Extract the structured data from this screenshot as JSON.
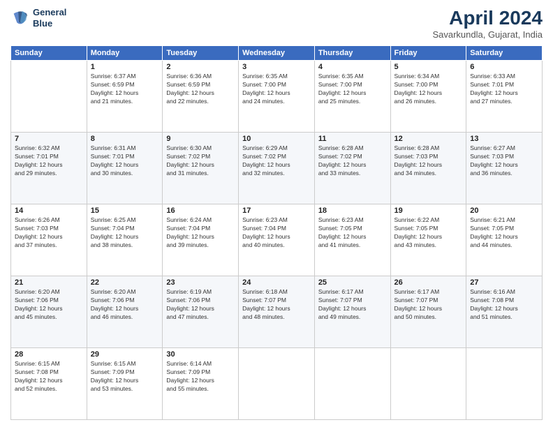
{
  "header": {
    "logo_line1": "General",
    "logo_line2": "Blue",
    "title": "April 2024",
    "subtitle": "Savarkundla, Gujarat, India"
  },
  "days_of_week": [
    "Sunday",
    "Monday",
    "Tuesday",
    "Wednesday",
    "Thursday",
    "Friday",
    "Saturday"
  ],
  "weeks": [
    [
      {
        "day": "",
        "info": ""
      },
      {
        "day": "1",
        "info": "Sunrise: 6:37 AM\nSunset: 6:59 PM\nDaylight: 12 hours\nand 21 minutes."
      },
      {
        "day": "2",
        "info": "Sunrise: 6:36 AM\nSunset: 6:59 PM\nDaylight: 12 hours\nand 22 minutes."
      },
      {
        "day": "3",
        "info": "Sunrise: 6:35 AM\nSunset: 7:00 PM\nDaylight: 12 hours\nand 24 minutes."
      },
      {
        "day": "4",
        "info": "Sunrise: 6:35 AM\nSunset: 7:00 PM\nDaylight: 12 hours\nand 25 minutes."
      },
      {
        "day": "5",
        "info": "Sunrise: 6:34 AM\nSunset: 7:00 PM\nDaylight: 12 hours\nand 26 minutes."
      },
      {
        "day": "6",
        "info": "Sunrise: 6:33 AM\nSunset: 7:01 PM\nDaylight: 12 hours\nand 27 minutes."
      }
    ],
    [
      {
        "day": "7",
        "info": "Sunrise: 6:32 AM\nSunset: 7:01 PM\nDaylight: 12 hours\nand 29 minutes."
      },
      {
        "day": "8",
        "info": "Sunrise: 6:31 AM\nSunset: 7:01 PM\nDaylight: 12 hours\nand 30 minutes."
      },
      {
        "day": "9",
        "info": "Sunrise: 6:30 AM\nSunset: 7:02 PM\nDaylight: 12 hours\nand 31 minutes."
      },
      {
        "day": "10",
        "info": "Sunrise: 6:29 AM\nSunset: 7:02 PM\nDaylight: 12 hours\nand 32 minutes."
      },
      {
        "day": "11",
        "info": "Sunrise: 6:28 AM\nSunset: 7:02 PM\nDaylight: 12 hours\nand 33 minutes."
      },
      {
        "day": "12",
        "info": "Sunrise: 6:28 AM\nSunset: 7:03 PM\nDaylight: 12 hours\nand 34 minutes."
      },
      {
        "day": "13",
        "info": "Sunrise: 6:27 AM\nSunset: 7:03 PM\nDaylight: 12 hours\nand 36 minutes."
      }
    ],
    [
      {
        "day": "14",
        "info": "Sunrise: 6:26 AM\nSunset: 7:03 PM\nDaylight: 12 hours\nand 37 minutes."
      },
      {
        "day": "15",
        "info": "Sunrise: 6:25 AM\nSunset: 7:04 PM\nDaylight: 12 hours\nand 38 minutes."
      },
      {
        "day": "16",
        "info": "Sunrise: 6:24 AM\nSunset: 7:04 PM\nDaylight: 12 hours\nand 39 minutes."
      },
      {
        "day": "17",
        "info": "Sunrise: 6:23 AM\nSunset: 7:04 PM\nDaylight: 12 hours\nand 40 minutes."
      },
      {
        "day": "18",
        "info": "Sunrise: 6:23 AM\nSunset: 7:05 PM\nDaylight: 12 hours\nand 41 minutes."
      },
      {
        "day": "19",
        "info": "Sunrise: 6:22 AM\nSunset: 7:05 PM\nDaylight: 12 hours\nand 43 minutes."
      },
      {
        "day": "20",
        "info": "Sunrise: 6:21 AM\nSunset: 7:05 PM\nDaylight: 12 hours\nand 44 minutes."
      }
    ],
    [
      {
        "day": "21",
        "info": "Sunrise: 6:20 AM\nSunset: 7:06 PM\nDaylight: 12 hours\nand 45 minutes."
      },
      {
        "day": "22",
        "info": "Sunrise: 6:20 AM\nSunset: 7:06 PM\nDaylight: 12 hours\nand 46 minutes."
      },
      {
        "day": "23",
        "info": "Sunrise: 6:19 AM\nSunset: 7:06 PM\nDaylight: 12 hours\nand 47 minutes."
      },
      {
        "day": "24",
        "info": "Sunrise: 6:18 AM\nSunset: 7:07 PM\nDaylight: 12 hours\nand 48 minutes."
      },
      {
        "day": "25",
        "info": "Sunrise: 6:17 AM\nSunset: 7:07 PM\nDaylight: 12 hours\nand 49 minutes."
      },
      {
        "day": "26",
        "info": "Sunrise: 6:17 AM\nSunset: 7:07 PM\nDaylight: 12 hours\nand 50 minutes."
      },
      {
        "day": "27",
        "info": "Sunrise: 6:16 AM\nSunset: 7:08 PM\nDaylight: 12 hours\nand 51 minutes."
      }
    ],
    [
      {
        "day": "28",
        "info": "Sunrise: 6:15 AM\nSunset: 7:08 PM\nDaylight: 12 hours\nand 52 minutes."
      },
      {
        "day": "29",
        "info": "Sunrise: 6:15 AM\nSunset: 7:09 PM\nDaylight: 12 hours\nand 53 minutes."
      },
      {
        "day": "30",
        "info": "Sunrise: 6:14 AM\nSunset: 7:09 PM\nDaylight: 12 hours\nand 55 minutes."
      },
      {
        "day": "",
        "info": ""
      },
      {
        "day": "",
        "info": ""
      },
      {
        "day": "",
        "info": ""
      },
      {
        "day": "",
        "info": ""
      }
    ]
  ]
}
